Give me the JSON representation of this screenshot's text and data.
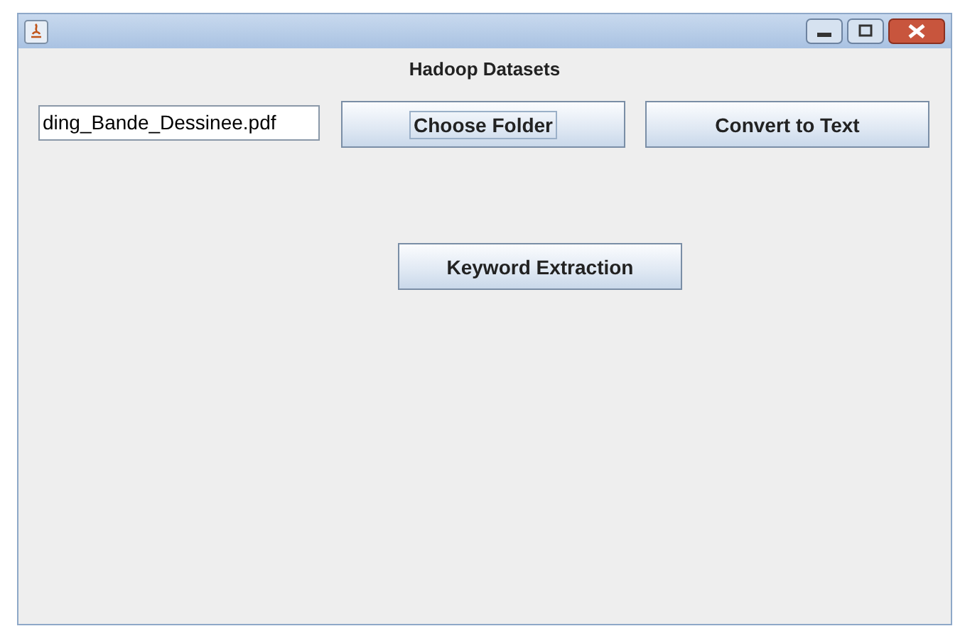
{
  "window": {
    "title_heading": "Hadoop Datasets"
  },
  "file_field": {
    "value": "ding_Bande_Dessinee.pdf"
  },
  "buttons": [
    {
      "label": "Choose Folder",
      "focused": true
    },
    {
      "label": "Convert to Text",
      "focused": false
    },
    {
      "label": "Keyword Extraction",
      "focused": false
    }
  ]
}
